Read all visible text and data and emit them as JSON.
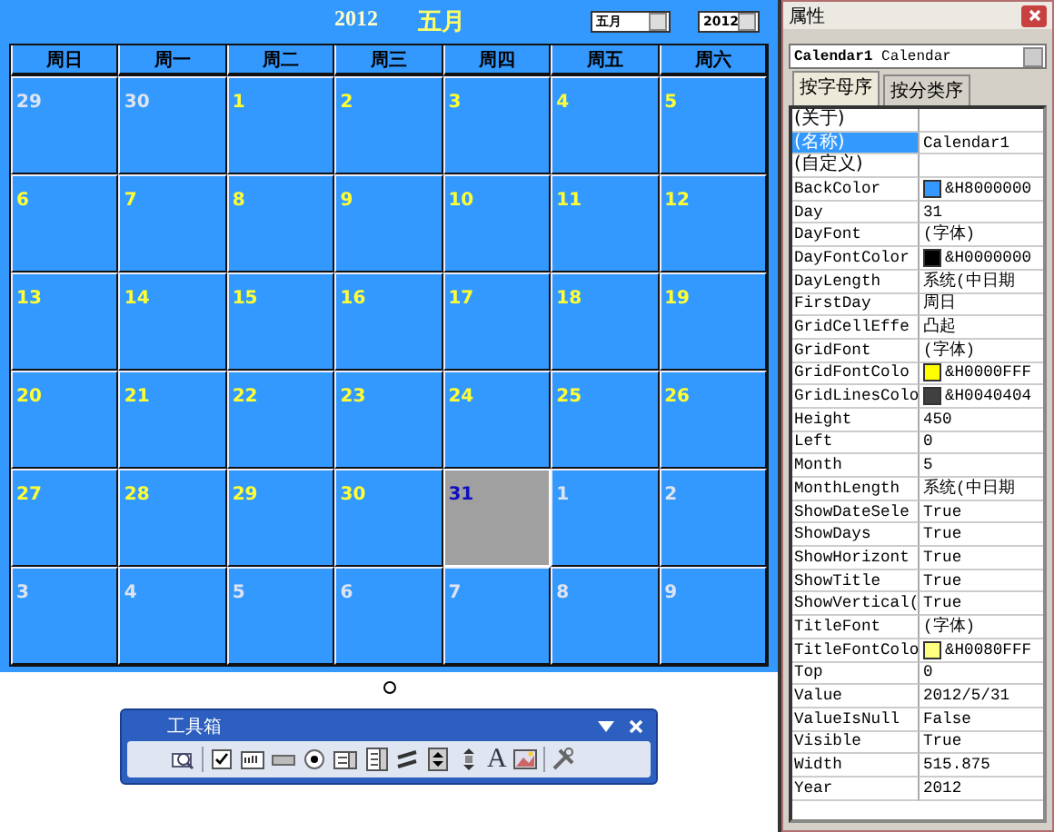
{
  "calendar": {
    "title_year": "2012",
    "title_month": "五月",
    "month_select": "五月",
    "year_select": "2012",
    "weekdays": [
      "周日",
      "周一",
      "周二",
      "周三",
      "周四",
      "周五",
      "周六"
    ],
    "weeks": [
      [
        {
          "day": "29",
          "other_month": true,
          "selected": false
        },
        {
          "day": "30",
          "other_month": true,
          "selected": false
        },
        {
          "day": "1",
          "other_month": false,
          "selected": false
        },
        {
          "day": "2",
          "other_month": false,
          "selected": false
        },
        {
          "day": "3",
          "other_month": false,
          "selected": false
        },
        {
          "day": "4",
          "other_month": false,
          "selected": false
        },
        {
          "day": "5",
          "other_month": false,
          "selected": false
        }
      ],
      [
        {
          "day": "6",
          "other_month": false,
          "selected": false
        },
        {
          "day": "7",
          "other_month": false,
          "selected": false
        },
        {
          "day": "8",
          "other_month": false,
          "selected": false
        },
        {
          "day": "9",
          "other_month": false,
          "selected": false
        },
        {
          "day": "10",
          "other_month": false,
          "selected": false
        },
        {
          "day": "11",
          "other_month": false,
          "selected": false
        },
        {
          "day": "12",
          "other_month": false,
          "selected": false
        }
      ],
      [
        {
          "day": "13",
          "other_month": false,
          "selected": false
        },
        {
          "day": "14",
          "other_month": false,
          "selected": false
        },
        {
          "day": "15",
          "other_month": false,
          "selected": false
        },
        {
          "day": "16",
          "other_month": false,
          "selected": false
        },
        {
          "day": "17",
          "other_month": false,
          "selected": false
        },
        {
          "day": "18",
          "other_month": false,
          "selected": false
        },
        {
          "day": "19",
          "other_month": false,
          "selected": false
        }
      ],
      [
        {
          "day": "20",
          "other_month": false,
          "selected": false
        },
        {
          "day": "21",
          "other_month": false,
          "selected": false
        },
        {
          "day": "22",
          "other_month": false,
          "selected": false
        },
        {
          "day": "23",
          "other_month": false,
          "selected": false
        },
        {
          "day": "24",
          "other_month": false,
          "selected": false
        },
        {
          "day": "25",
          "other_month": false,
          "selected": false
        },
        {
          "day": "26",
          "other_month": false,
          "selected": false
        }
      ],
      [
        {
          "day": "27",
          "other_month": false,
          "selected": false
        },
        {
          "day": "28",
          "other_month": false,
          "selected": false
        },
        {
          "day": "29",
          "other_month": false,
          "selected": false
        },
        {
          "day": "30",
          "other_month": false,
          "selected": false
        },
        {
          "day": "31",
          "other_month": false,
          "selected": true
        },
        {
          "day": "1",
          "other_month": true,
          "selected": false
        },
        {
          "day": "2",
          "other_month": true,
          "selected": false
        }
      ],
      [
        {
          "day": "3",
          "other_month": true,
          "selected": false
        },
        {
          "day": "4",
          "other_month": true,
          "selected": false
        },
        {
          "day": "5",
          "other_month": true,
          "selected": false
        },
        {
          "day": "6",
          "other_month": true,
          "selected": false
        },
        {
          "day": "7",
          "other_month": true,
          "selected": false
        },
        {
          "day": "8",
          "other_month": true,
          "selected": false
        },
        {
          "day": "9",
          "other_month": true,
          "selected": false
        }
      ]
    ]
  },
  "toolbox": {
    "title": "工具箱",
    "tools": [
      {
        "kind": "more"
      },
      {
        "kind": "checkbox"
      },
      {
        "kind": "textbox"
      },
      {
        "kind": "button"
      },
      {
        "kind": "option"
      },
      {
        "kind": "listbox"
      },
      {
        "kind": "combobox"
      },
      {
        "kind": "toggle"
      },
      {
        "kind": "spin"
      },
      {
        "kind": "scrollbar"
      },
      {
        "kind": "label",
        "glyph": "A"
      },
      {
        "kind": "image"
      },
      {
        "kind": "tools"
      }
    ]
  },
  "properties": {
    "title": "属性",
    "object_select": "**Calendar1** Calendar",
    "tabs": [
      {
        "label": "按字母序",
        "selected": true
      },
      {
        "label": "按分类序",
        "selected": false
      }
    ],
    "rows": [
      {
        "name": "(关于)",
        "value": "",
        "selected": false
      },
      {
        "name": "(名称)",
        "value": "Calendar1",
        "selected": true
      },
      {
        "name": "(自定义)",
        "value": "",
        "selected": false
      },
      {
        "name": "BackColor",
        "value": "&H8000000",
        "color": "#3399ff",
        "selected": false
      },
      {
        "name": "Day",
        "value": "31",
        "selected": false
      },
      {
        "name": "DayFont",
        "value": "(字体)",
        "selected": false
      },
      {
        "name": "DayFontColor",
        "value": "&H0000000",
        "color": "#000000",
        "selected": false
      },
      {
        "name": "DayLength",
        "value": "系统(中日期",
        "selected": false
      },
      {
        "name": "FirstDay",
        "value": "周日",
        "selected": false
      },
      {
        "name": "GridCellEffe",
        "value": "凸起",
        "selected": false
      },
      {
        "name": "GridFont",
        "value": "(字体)",
        "selected": false
      },
      {
        "name": "GridFontColo",
        "value": "&H0000FFF",
        "color": "#ffff00",
        "selected": false
      },
      {
        "name": "GridLinesColo",
        "value": "&H0040404",
        "color": "#404040",
        "selected": false
      },
      {
        "name": "Height",
        "value": "450",
        "selected": false
      },
      {
        "name": "Left",
        "value": "0",
        "selected": false
      },
      {
        "name": "Month",
        "value": "5",
        "selected": false
      },
      {
        "name": "MonthLength",
        "value": "系统(中日期",
        "selected": false
      },
      {
        "name": "ShowDateSele",
        "value": "True",
        "selected": false
      },
      {
        "name": "ShowDays",
        "value": "True",
        "selected": false
      },
      {
        "name": "ShowHorizont",
        "value": "True",
        "selected": false
      },
      {
        "name": "ShowTitle",
        "value": "True",
        "selected": false
      },
      {
        "name": "ShowVertical(",
        "value": "True",
        "selected": false
      },
      {
        "name": "TitleFont",
        "value": "(字体)",
        "selected": false
      },
      {
        "name": "TitleFontColo",
        "value": "&H0080FFF",
        "color": "#ffff80",
        "selected": false
      },
      {
        "name": "Top",
        "value": "0",
        "selected": false
      },
      {
        "name": "Value",
        "value": "2012/5/31",
        "selected": false
      },
      {
        "name": "ValueIsNull",
        "value": "False",
        "selected": false
      },
      {
        "name": "Visible",
        "value": "True",
        "selected": false
      },
      {
        "name": "Width",
        "value": "515.875",
        "selected": false
      },
      {
        "name": "Year",
        "value": "2012",
        "selected": false
      }
    ]
  }
}
